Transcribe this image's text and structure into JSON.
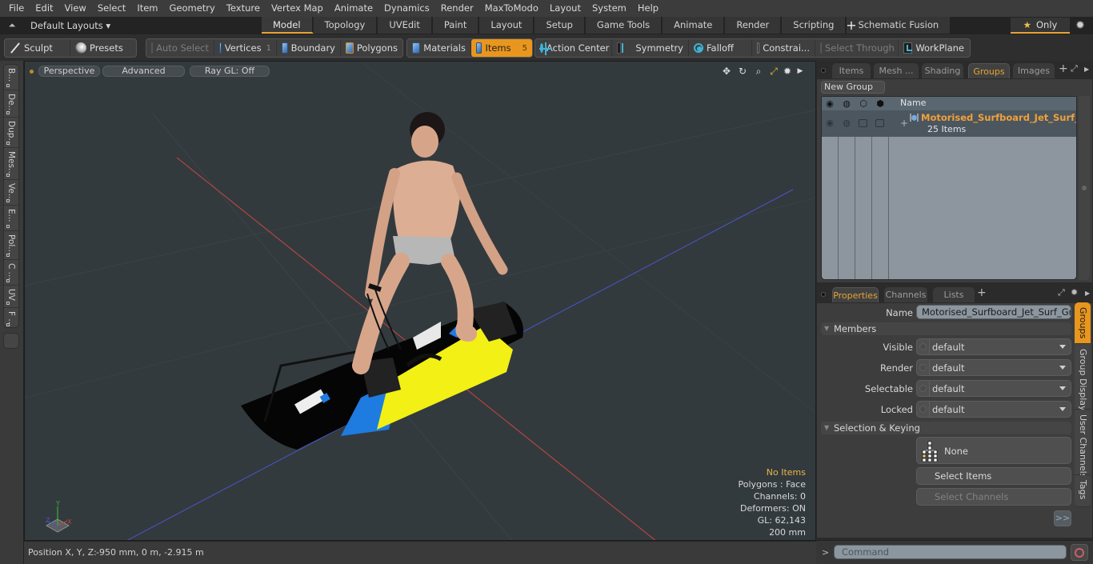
{
  "menu": [
    "File",
    "Edit",
    "View",
    "Select",
    "Item",
    "Geometry",
    "Texture",
    "Vertex Map",
    "Animate",
    "Dynamics",
    "Render",
    "MaxToModo",
    "Layout",
    "System",
    "Help"
  ],
  "layoutbar": {
    "layout_select": "Default Layouts ▾",
    "tabs": [
      {
        "label": "Model",
        "active": true
      },
      {
        "label": "Topology"
      },
      {
        "label": "UVEdit"
      },
      {
        "label": "Paint"
      },
      {
        "label": "Layout"
      },
      {
        "label": "Setup"
      },
      {
        "label": "Game Tools"
      },
      {
        "label": "Animate"
      },
      {
        "label": "Render"
      },
      {
        "label": "Scripting"
      },
      {
        "label": "Schematic Fusion"
      }
    ],
    "add_tab": "+",
    "only_label": "Only",
    "star": "★"
  },
  "toolbar": {
    "sculpt": "Sculpt",
    "presets": "Presets",
    "auto_select": "Auto Select",
    "vertices": "Vertices",
    "vertices_count": "1",
    "boundary": "Boundary",
    "polygons": "Polygons",
    "materials": "Materials",
    "items": "Items",
    "items_count": "5",
    "action_center": "Action Center",
    "symmetry": "Symmetry",
    "falloff": "Falloff",
    "constraints": "Constrai...",
    "select_through": "Select Through",
    "workplane": "WorkPlane"
  },
  "left_tabs": [
    "B...",
    "De...",
    "Dup...",
    "Mes...",
    "Ve...",
    "E...",
    "Pol...",
    "C ...",
    "UV",
    "F ..."
  ],
  "viewport": {
    "perspective": "Perspective",
    "advanced": "Advanced",
    "raygl": "Ray GL: Off",
    "info": {
      "selection": "No Items",
      "polygons": "Polygons : Face",
      "channels": "Channels: 0",
      "deformers": "Deformers: ON",
      "gl": "GL: 62,143",
      "grid": "200 mm"
    },
    "axis_x": "X",
    "axis_y": "Y",
    "axis_z": "Z",
    "colors": {
      "x_axis": "#c8463e",
      "z_axis": "#4a55c8",
      "bg": "#333a3e"
    }
  },
  "statusbar": {
    "label": "Position X, Y, Z:",
    "value": "-950 mm, 0 m, -2.915 m"
  },
  "groups_panel": {
    "tabs": [
      {
        "label": "Items"
      },
      {
        "label": "Mesh ..."
      },
      {
        "label": "Shading"
      },
      {
        "label": "Groups",
        "active": true
      },
      {
        "label": "Images"
      }
    ],
    "new_group": "New Group",
    "column_name": "Name",
    "group": {
      "name": "Motorised_Surfboard_Jet_Surf_...",
      "count": "25 Items"
    }
  },
  "properties_panel": {
    "tabs": [
      {
        "label": "Properties",
        "active": true
      },
      {
        "label": "Channels"
      },
      {
        "label": "Lists"
      }
    ],
    "name_label": "Name",
    "name_value": "Motorised_Surfboard_Jet_Surf_Green",
    "members_section": "Members",
    "members": [
      {
        "label": "Visible",
        "value": "default"
      },
      {
        "label": "Render",
        "value": "default"
      },
      {
        "label": "Selectable",
        "value": "default"
      },
      {
        "label": "Locked",
        "value": "default"
      }
    ],
    "selection_section": "Selection & Keying",
    "none_button": "None",
    "select_items": "Select Items",
    "select_channels": "Select Channels",
    "more": ">>",
    "side_tabs": [
      {
        "label": "Groups",
        "active": true
      },
      {
        "label": "Group Display"
      },
      {
        "label": "User Channels"
      },
      {
        "label": "Tags"
      }
    ]
  },
  "command": {
    "prompt": ">",
    "placeholder": "Command"
  },
  "accent_color": "#e8961e"
}
